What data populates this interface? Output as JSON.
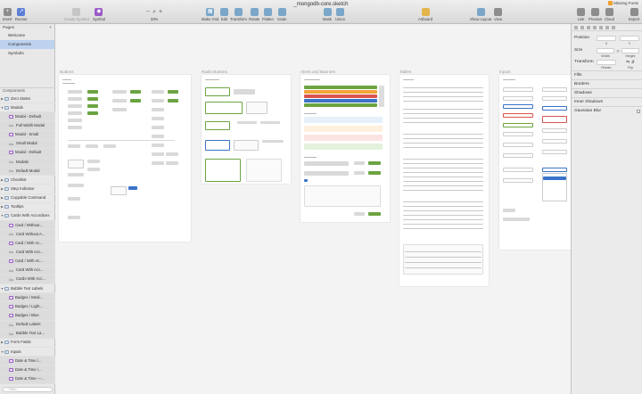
{
  "window": {
    "title": "_mongodb-core.sketch"
  },
  "toolbar": {
    "left": [
      {
        "label": "Insert",
        "icon": "plus-icon"
      },
      {
        "label": "Runner",
        "icon": "runner-icon"
      }
    ],
    "tools": [
      {
        "label": "Create Symbol",
        "icon": "create-symbol-icon",
        "dim": true
      },
      {
        "label": "Symbol",
        "icon": "symbol-icon",
        "dim": false
      }
    ],
    "zoom": {
      "minus": "−",
      "value": "33%",
      "plus": "+"
    },
    "arrange": [
      {
        "label": "Make Grid",
        "icon": "make-grid-icon"
      },
      {
        "label": "Edit",
        "icon": "edit-icon"
      },
      {
        "label": "Transform",
        "icon": "transform-icon"
      },
      {
        "label": "Rotate",
        "icon": "rotate-icon"
      },
      {
        "label": "Flatten",
        "icon": "flatten-icon"
      },
      {
        "label": "Scale",
        "icon": "scale-icon"
      }
    ],
    "mask": [
      {
        "label": "Mask",
        "icon": "mask-icon"
      },
      {
        "label": "Union",
        "icon": "union-icon"
      }
    ],
    "artboard": {
      "label": "Artboard",
      "icon": "artboard-icon"
    },
    "view": [
      {
        "label": "Show Layout",
        "icon": "show-layout-icon"
      },
      {
        "label": "View",
        "icon": "view-icon"
      }
    ],
    "right": [
      {
        "label": "Link",
        "icon": "link-icon"
      },
      {
        "label": "Preview",
        "icon": "preview-icon"
      },
      {
        "label": "Cloud",
        "icon": "cloud-icon"
      },
      {
        "label": "Export",
        "icon": "export-icon"
      }
    ],
    "missing_fonts": "Missing Fonts"
  },
  "pages": {
    "header": "Pages",
    "items": [
      {
        "label": "Welcome",
        "selected": false
      },
      {
        "label": "Components",
        "selected": true
      },
      {
        "label": "Symbols",
        "selected": false
      }
    ]
  },
  "layers": {
    "header": "Components",
    "items": [
      {
        "label": "Zero States",
        "kind": "group",
        "level": 0,
        "arrow": "▶"
      },
      {
        "label": "Modals",
        "kind": "group",
        "level": 0,
        "arrow": "▼"
      },
      {
        "label": "Modal - Default",
        "kind": "sym",
        "level": 1
      },
      {
        "label": "Full Width Modal",
        "kind": "txt",
        "level": 1
      },
      {
        "label": "Modal - Small",
        "kind": "sym",
        "level": 1
      },
      {
        "label": "Small Modal",
        "kind": "txt",
        "level": 1
      },
      {
        "label": "Modal - Default",
        "kind": "sym",
        "level": 1
      },
      {
        "label": "Modals",
        "kind": "txt",
        "level": 1
      },
      {
        "label": "Default Modal",
        "kind": "txt",
        "level": 1
      },
      {
        "label": "Checklist",
        "kind": "group",
        "level": 0,
        "arrow": "▶"
      },
      {
        "label": "Step Indicator",
        "kind": "group",
        "level": 0,
        "arrow": "▶"
      },
      {
        "label": "Copyable Command",
        "kind": "group",
        "level": 0,
        "arrow": "▶"
      },
      {
        "label": "Tooltips",
        "kind": "group",
        "level": 0,
        "arrow": "▶"
      },
      {
        "label": "Cards With Accordions",
        "kind": "group",
        "level": 0,
        "arrow": "▼"
      },
      {
        "label": "Card / Without...",
        "kind": "sym",
        "level": 1
      },
      {
        "label": "Card Without A...",
        "kind": "txt",
        "level": 1
      },
      {
        "label": "Card / With Ac...",
        "kind": "sym",
        "level": 1
      },
      {
        "label": "Card With Acc...",
        "kind": "txt",
        "level": 1
      },
      {
        "label": "Card / With Ac...",
        "kind": "sym",
        "level": 1
      },
      {
        "label": "Card With Acc...",
        "kind": "txt",
        "level": 1
      },
      {
        "label": "Cards With Acc...",
        "kind": "txt",
        "level": 1
      },
      {
        "label": "Bubble Text Labels",
        "kind": "group",
        "level": 0,
        "arrow": "▼"
      },
      {
        "label": "Badges / Medi...",
        "kind": "sym",
        "level": 1
      },
      {
        "label": "Badges / Light...",
        "kind": "sym",
        "level": 1
      },
      {
        "label": "Badges / Blue",
        "kind": "sym",
        "level": 1
      },
      {
        "label": "Default Labels",
        "kind": "txt",
        "level": 1
      },
      {
        "label": "Bubble Text La...",
        "kind": "txt",
        "level": 1
      },
      {
        "label": "Form Fields",
        "kind": "group",
        "level": 0,
        "arrow": "▶"
      },
      {
        "label": "Inputs",
        "kind": "group",
        "level": 0,
        "arrow": "▼"
      },
      {
        "label": "Date & Time /...",
        "kind": "sym",
        "level": 1
      },
      {
        "label": "Date & Time /...",
        "kind": "sym",
        "level": 1
      },
      {
        "label": "Date & Time —...",
        "kind": "sym",
        "level": 1
      }
    ],
    "filter_placeholder": "Filter"
  },
  "artboards": [
    {
      "title": "Buttons"
    },
    {
      "title": "Radio Buttons"
    },
    {
      "title": "Alerts and Banners"
    },
    {
      "title": "Tables"
    },
    {
      "title": "Inputs"
    }
  ],
  "inspector": {
    "position": "Position",
    "x_label": "X",
    "y_label": "Y",
    "size": "Size",
    "width_label": "Width",
    "height_label": "Height",
    "transform": "Transform",
    "rotate_label": "Rotate",
    "flip_label": "Flip",
    "fills": "Fills",
    "borders": "Borders",
    "shadows": "Shadows",
    "inner_shadows": "Inner Shadows",
    "gaussian_blur": "Gaussian Blur"
  },
  "colors": {
    "accent_green": "#6ba442",
    "selection": "#bcd2ee"
  }
}
